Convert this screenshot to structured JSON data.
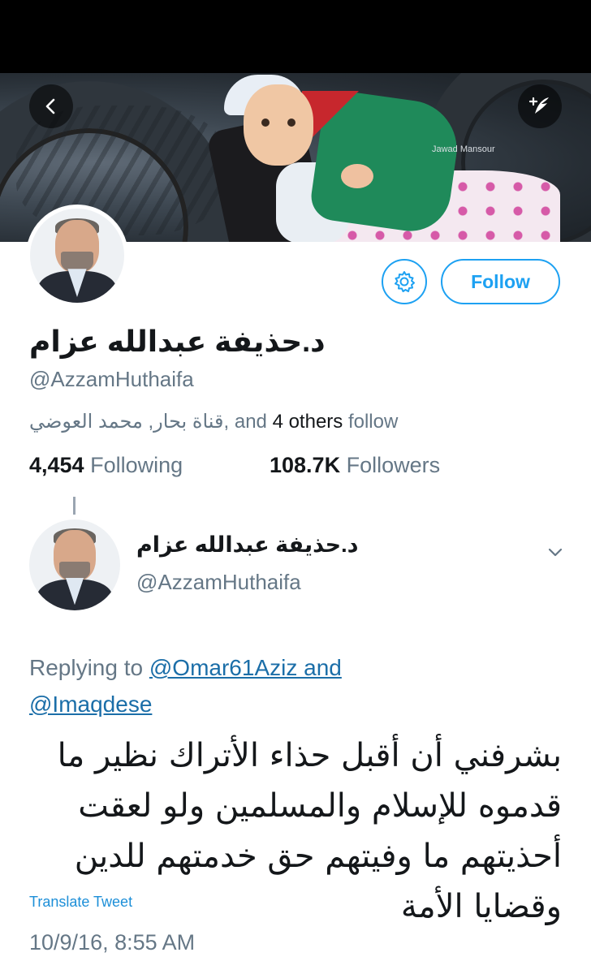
{
  "banner": {
    "watermark": "Jawad Mansour"
  },
  "icons": {
    "back": "chevron-left-icon",
    "compose": "compose-icon",
    "settings": "gear-icon",
    "caret": "chevron-down-icon"
  },
  "profile": {
    "display_name": "د.حذيفة عبدالله عزام",
    "handle": "@AzzamHuthaifa",
    "follow_label": "Follow",
    "followed_by": "قناة بحار, محمد العوضي",
    "followed_by_suffix": ", and ",
    "followed_by_count": "4 others",
    "followed_by_tail": " follow",
    "following_count": "4,454",
    "following_label": "Following",
    "followers_count": "108.7K",
    "followers_label": "Followers"
  },
  "tweet": {
    "author_name": "د.حذيفة عبدالله عزام",
    "author_handle": "@AzzamHuthaifa",
    "replying_prefix": "Replying to ",
    "replying_to_1": "@Omar61Aziz and",
    "replying_to_2": "@Imaqdese",
    "text": "بشرفني أن أقبل حذاء الأتراك نظير ما قدموه للإسلام والمسلمين ولو لعقت أحذيتهم ما وفيتهم حق خدمتهم للدين وقضايا الأمة",
    "translate_label": "Translate Tweet",
    "timestamp": "10/9/16, 8:55 AM"
  },
  "colors": {
    "accent": "#1da1f2",
    "link": "#1b6ea8",
    "secondary_text": "#657786",
    "primary_text": "#14171a"
  }
}
